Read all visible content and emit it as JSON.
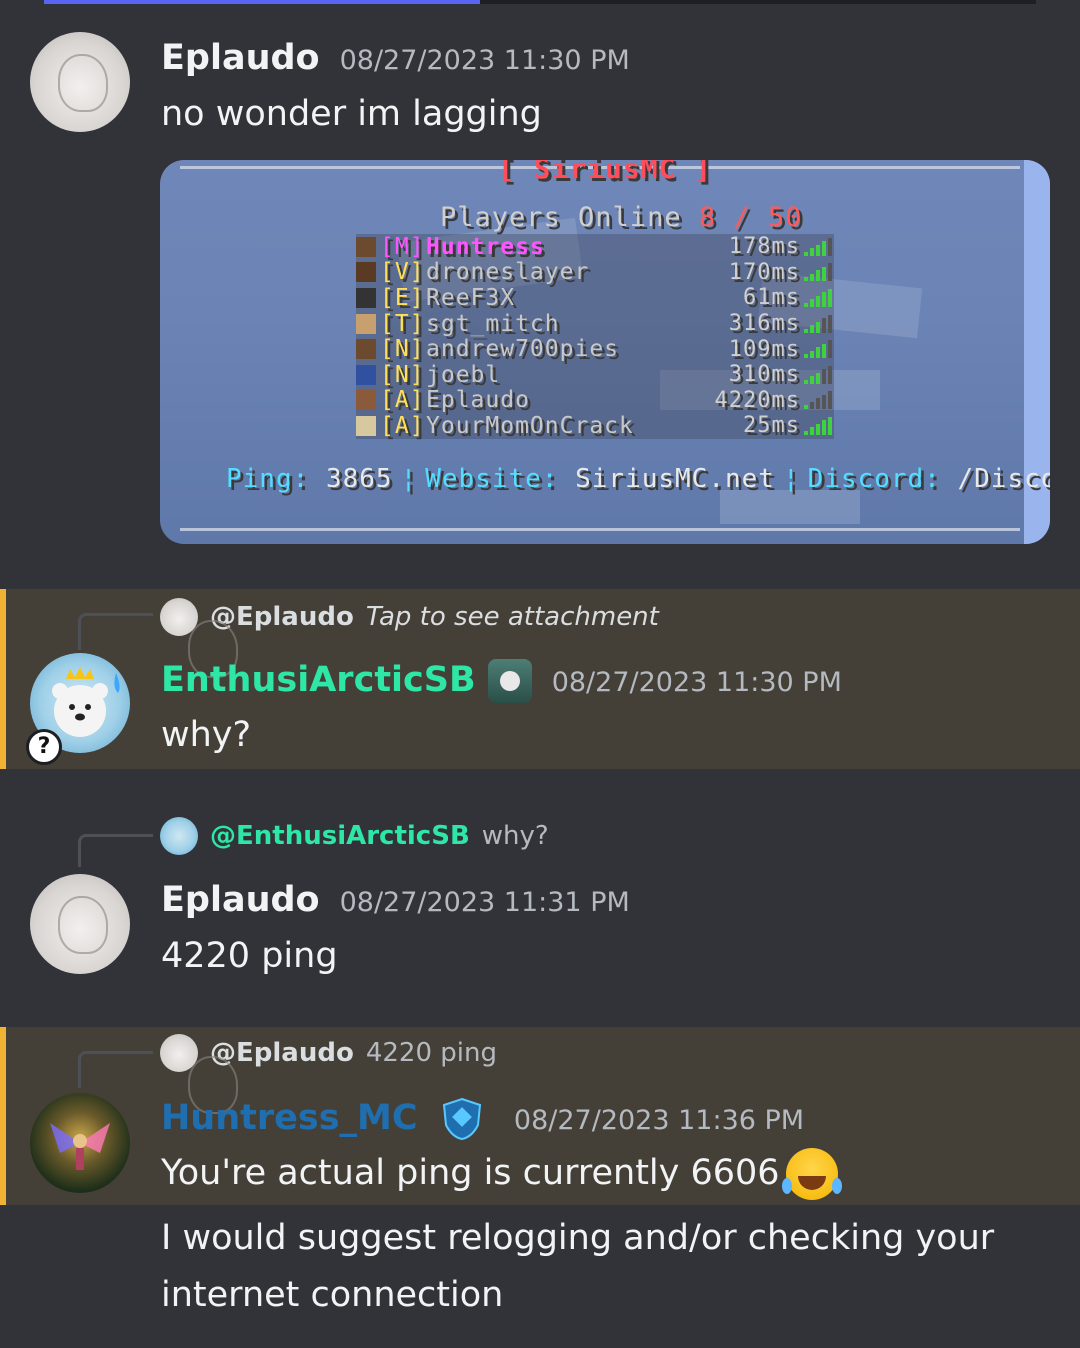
{
  "colors": {
    "background": "#313338",
    "highlight": "#444038",
    "highlight_bar": "#f0b232",
    "name_default": "#f2f3f5",
    "name_enthusi": "#2ee6a6",
    "name_huntress": "#1f6fb0"
  },
  "progress": 0.44,
  "messages": [
    {
      "author": "Eplaudo",
      "timestamp": "08/27/2023 11:30 PM",
      "text": "no wonder im lagging",
      "avatar": "sketch-avatar"
    },
    {
      "reply_to": {
        "name": "@Eplaudo",
        "text": "Tap to see attachment"
      },
      "author": "EnthusiArcticSB",
      "timestamp": "08/27/2023 11:30 PM",
      "text": "why?",
      "avatar": "polar-bear-avatar"
    },
    {
      "reply_to": {
        "name": "@EnthusiArcticSB",
        "text": "why?"
      },
      "author": "Eplaudo",
      "timestamp": "08/27/2023 11:31 PM",
      "text": "4220 ping",
      "avatar": "sketch-avatar"
    },
    {
      "reply_to": {
        "name": "@Eplaudo",
        "text": "4220 ping"
      },
      "author": "Huntress_MC",
      "timestamp": "08/27/2023 11:36 PM",
      "text": "You're actual ping is currently 6606",
      "text2": "I would suggest relogging and/or checking your",
      "text3": "internet connection",
      "avatar": "fairy-avatar"
    }
  ],
  "screenshot": {
    "title": "[ SiriusMC ]",
    "online_label": "Players Online",
    "online_count": "8 / 50",
    "players": [
      {
        "rank": "[M]",
        "name": "Huntress",
        "ping": "178ms",
        "rank_color": "#ff55ff",
        "name_color": "#ff55ff",
        "bars": 4
      },
      {
        "rank": "[V]",
        "name": "droneslayer",
        "ping": "170ms",
        "rank_color": "#ffdf5a",
        "name_color": "#c8c8c8",
        "bars": 4
      },
      {
        "rank": "[E]",
        "name": "ReeF3X",
        "ping": "61ms",
        "rank_color": "#ffdf5a",
        "name_color": "#c8c8c8",
        "bars": 5
      },
      {
        "rank": "[T]",
        "name": "sgt_mitch",
        "ping": "316ms",
        "rank_color": "#ffdf5a",
        "name_color": "#c8c8c8",
        "bars": 3
      },
      {
        "rank": "[N]",
        "name": "andrew700pies",
        "ping": "109ms",
        "rank_color": "#ffdf5a",
        "name_color": "#c8c8c8",
        "bars": 4
      },
      {
        "rank": "[N]",
        "name": "joebl",
        "ping": "310ms",
        "rank_color": "#ffdf5a",
        "name_color": "#c8c8c8",
        "bars": 3
      },
      {
        "rank": "[A]",
        "name": "Eplaudo",
        "ping": "4220ms",
        "rank_color": "#ffdf5a",
        "name_color": "#c8c8c8",
        "bars": 1
      },
      {
        "rank": "[A]",
        "name": "YourMomOnCrack",
        "ping": "25ms",
        "rank_color": "#ffdf5a",
        "name_color": "#c8c8c8",
        "bars": 5
      }
    ],
    "footer": {
      "ping_label": "Ping:",
      "ping_value": "3865",
      "website_label": "Website:",
      "website_value": "SiriusMC.net",
      "discord_label": "Discord:",
      "discord_value": "/Discord"
    }
  }
}
